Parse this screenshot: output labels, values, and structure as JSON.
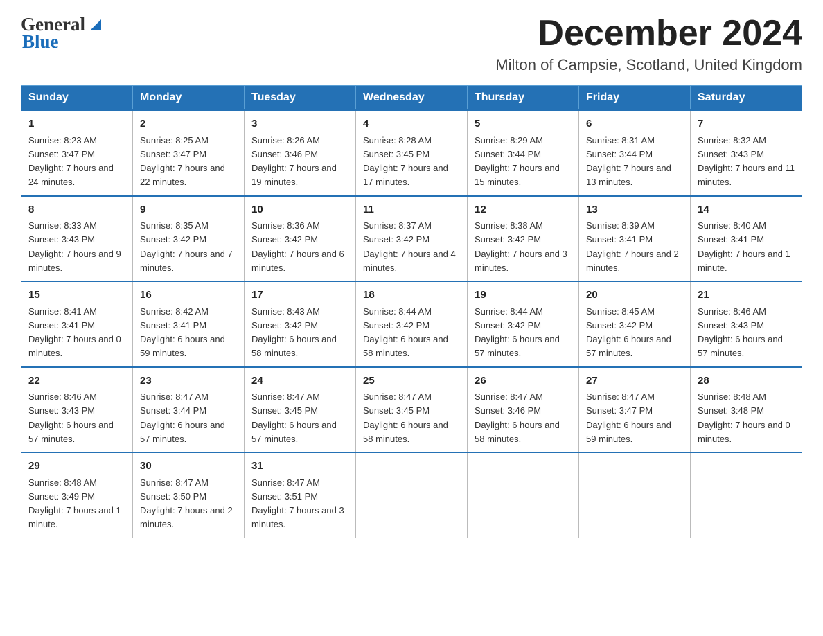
{
  "header": {
    "logo_line1": "General",
    "logo_line2": "Blue",
    "month_title": "December 2024",
    "location": "Milton of Campsie, Scotland, United Kingdom"
  },
  "days_of_week": [
    "Sunday",
    "Monday",
    "Tuesday",
    "Wednesday",
    "Thursday",
    "Friday",
    "Saturday"
  ],
  "weeks": [
    [
      {
        "day": "1",
        "sunrise": "Sunrise: 8:23 AM",
        "sunset": "Sunset: 3:47 PM",
        "daylight": "Daylight: 7 hours and 24 minutes."
      },
      {
        "day": "2",
        "sunrise": "Sunrise: 8:25 AM",
        "sunset": "Sunset: 3:47 PM",
        "daylight": "Daylight: 7 hours and 22 minutes."
      },
      {
        "day": "3",
        "sunrise": "Sunrise: 8:26 AM",
        "sunset": "Sunset: 3:46 PM",
        "daylight": "Daylight: 7 hours and 19 minutes."
      },
      {
        "day": "4",
        "sunrise": "Sunrise: 8:28 AM",
        "sunset": "Sunset: 3:45 PM",
        "daylight": "Daylight: 7 hours and 17 minutes."
      },
      {
        "day": "5",
        "sunrise": "Sunrise: 8:29 AM",
        "sunset": "Sunset: 3:44 PM",
        "daylight": "Daylight: 7 hours and 15 minutes."
      },
      {
        "day": "6",
        "sunrise": "Sunrise: 8:31 AM",
        "sunset": "Sunset: 3:44 PM",
        "daylight": "Daylight: 7 hours and 13 minutes."
      },
      {
        "day": "7",
        "sunrise": "Sunrise: 8:32 AM",
        "sunset": "Sunset: 3:43 PM",
        "daylight": "Daylight: 7 hours and 11 minutes."
      }
    ],
    [
      {
        "day": "8",
        "sunrise": "Sunrise: 8:33 AM",
        "sunset": "Sunset: 3:43 PM",
        "daylight": "Daylight: 7 hours and 9 minutes."
      },
      {
        "day": "9",
        "sunrise": "Sunrise: 8:35 AM",
        "sunset": "Sunset: 3:42 PM",
        "daylight": "Daylight: 7 hours and 7 minutes."
      },
      {
        "day": "10",
        "sunrise": "Sunrise: 8:36 AM",
        "sunset": "Sunset: 3:42 PM",
        "daylight": "Daylight: 7 hours and 6 minutes."
      },
      {
        "day": "11",
        "sunrise": "Sunrise: 8:37 AM",
        "sunset": "Sunset: 3:42 PM",
        "daylight": "Daylight: 7 hours and 4 minutes."
      },
      {
        "day": "12",
        "sunrise": "Sunrise: 8:38 AM",
        "sunset": "Sunset: 3:42 PM",
        "daylight": "Daylight: 7 hours and 3 minutes."
      },
      {
        "day": "13",
        "sunrise": "Sunrise: 8:39 AM",
        "sunset": "Sunset: 3:41 PM",
        "daylight": "Daylight: 7 hours and 2 minutes."
      },
      {
        "day": "14",
        "sunrise": "Sunrise: 8:40 AM",
        "sunset": "Sunset: 3:41 PM",
        "daylight": "Daylight: 7 hours and 1 minute."
      }
    ],
    [
      {
        "day": "15",
        "sunrise": "Sunrise: 8:41 AM",
        "sunset": "Sunset: 3:41 PM",
        "daylight": "Daylight: 7 hours and 0 minutes."
      },
      {
        "day": "16",
        "sunrise": "Sunrise: 8:42 AM",
        "sunset": "Sunset: 3:41 PM",
        "daylight": "Daylight: 6 hours and 59 minutes."
      },
      {
        "day": "17",
        "sunrise": "Sunrise: 8:43 AM",
        "sunset": "Sunset: 3:42 PM",
        "daylight": "Daylight: 6 hours and 58 minutes."
      },
      {
        "day": "18",
        "sunrise": "Sunrise: 8:44 AM",
        "sunset": "Sunset: 3:42 PM",
        "daylight": "Daylight: 6 hours and 58 minutes."
      },
      {
        "day": "19",
        "sunrise": "Sunrise: 8:44 AM",
        "sunset": "Sunset: 3:42 PM",
        "daylight": "Daylight: 6 hours and 57 minutes."
      },
      {
        "day": "20",
        "sunrise": "Sunrise: 8:45 AM",
        "sunset": "Sunset: 3:42 PM",
        "daylight": "Daylight: 6 hours and 57 minutes."
      },
      {
        "day": "21",
        "sunrise": "Sunrise: 8:46 AM",
        "sunset": "Sunset: 3:43 PM",
        "daylight": "Daylight: 6 hours and 57 minutes."
      }
    ],
    [
      {
        "day": "22",
        "sunrise": "Sunrise: 8:46 AM",
        "sunset": "Sunset: 3:43 PM",
        "daylight": "Daylight: 6 hours and 57 minutes."
      },
      {
        "day": "23",
        "sunrise": "Sunrise: 8:47 AM",
        "sunset": "Sunset: 3:44 PM",
        "daylight": "Daylight: 6 hours and 57 minutes."
      },
      {
        "day": "24",
        "sunrise": "Sunrise: 8:47 AM",
        "sunset": "Sunset: 3:45 PM",
        "daylight": "Daylight: 6 hours and 57 minutes."
      },
      {
        "day": "25",
        "sunrise": "Sunrise: 8:47 AM",
        "sunset": "Sunset: 3:45 PM",
        "daylight": "Daylight: 6 hours and 58 minutes."
      },
      {
        "day": "26",
        "sunrise": "Sunrise: 8:47 AM",
        "sunset": "Sunset: 3:46 PM",
        "daylight": "Daylight: 6 hours and 58 minutes."
      },
      {
        "day": "27",
        "sunrise": "Sunrise: 8:47 AM",
        "sunset": "Sunset: 3:47 PM",
        "daylight": "Daylight: 6 hours and 59 minutes."
      },
      {
        "day": "28",
        "sunrise": "Sunrise: 8:48 AM",
        "sunset": "Sunset: 3:48 PM",
        "daylight": "Daylight: 7 hours and 0 minutes."
      }
    ],
    [
      {
        "day": "29",
        "sunrise": "Sunrise: 8:48 AM",
        "sunset": "Sunset: 3:49 PM",
        "daylight": "Daylight: 7 hours and 1 minute."
      },
      {
        "day": "30",
        "sunrise": "Sunrise: 8:47 AM",
        "sunset": "Sunset: 3:50 PM",
        "daylight": "Daylight: 7 hours and 2 minutes."
      },
      {
        "day": "31",
        "sunrise": "Sunrise: 8:47 AM",
        "sunset": "Sunset: 3:51 PM",
        "daylight": "Daylight: 7 hours and 3 minutes."
      },
      null,
      null,
      null,
      null
    ]
  ]
}
